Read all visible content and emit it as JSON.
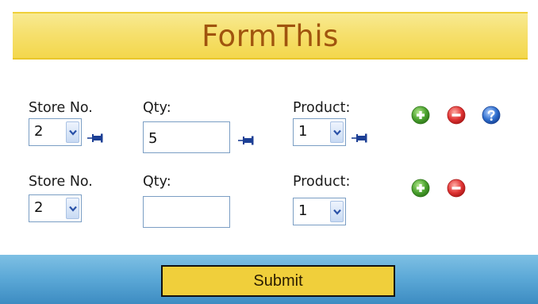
{
  "title": "FormThis",
  "rows": [
    {
      "store_label": "Store No.",
      "store_value": "2",
      "qty_label": "Qty:",
      "qty_value": "5",
      "product_label": "Product:",
      "product_value": "1"
    },
    {
      "store_label": "Store No.",
      "store_value": "2",
      "qty_label": "Qty:",
      "qty_value": "",
      "product_label": "Product:",
      "product_value": "1"
    }
  ],
  "submit_label": "Submit",
  "icons": {
    "dropdown": "chevron-down-icon",
    "pin": "pin-icon",
    "add": "add-icon",
    "remove": "remove-icon",
    "help": "help-icon"
  },
  "colors": {
    "title_banner": "#f6e06e",
    "title_text": "#a0540e",
    "footer": "#5aa7d6",
    "submit_button": "#f0cf3b",
    "add_green": "#4aa12e",
    "remove_red": "#e03434",
    "help_blue": "#2f6fcf",
    "pin_blue": "#1c3f95"
  }
}
